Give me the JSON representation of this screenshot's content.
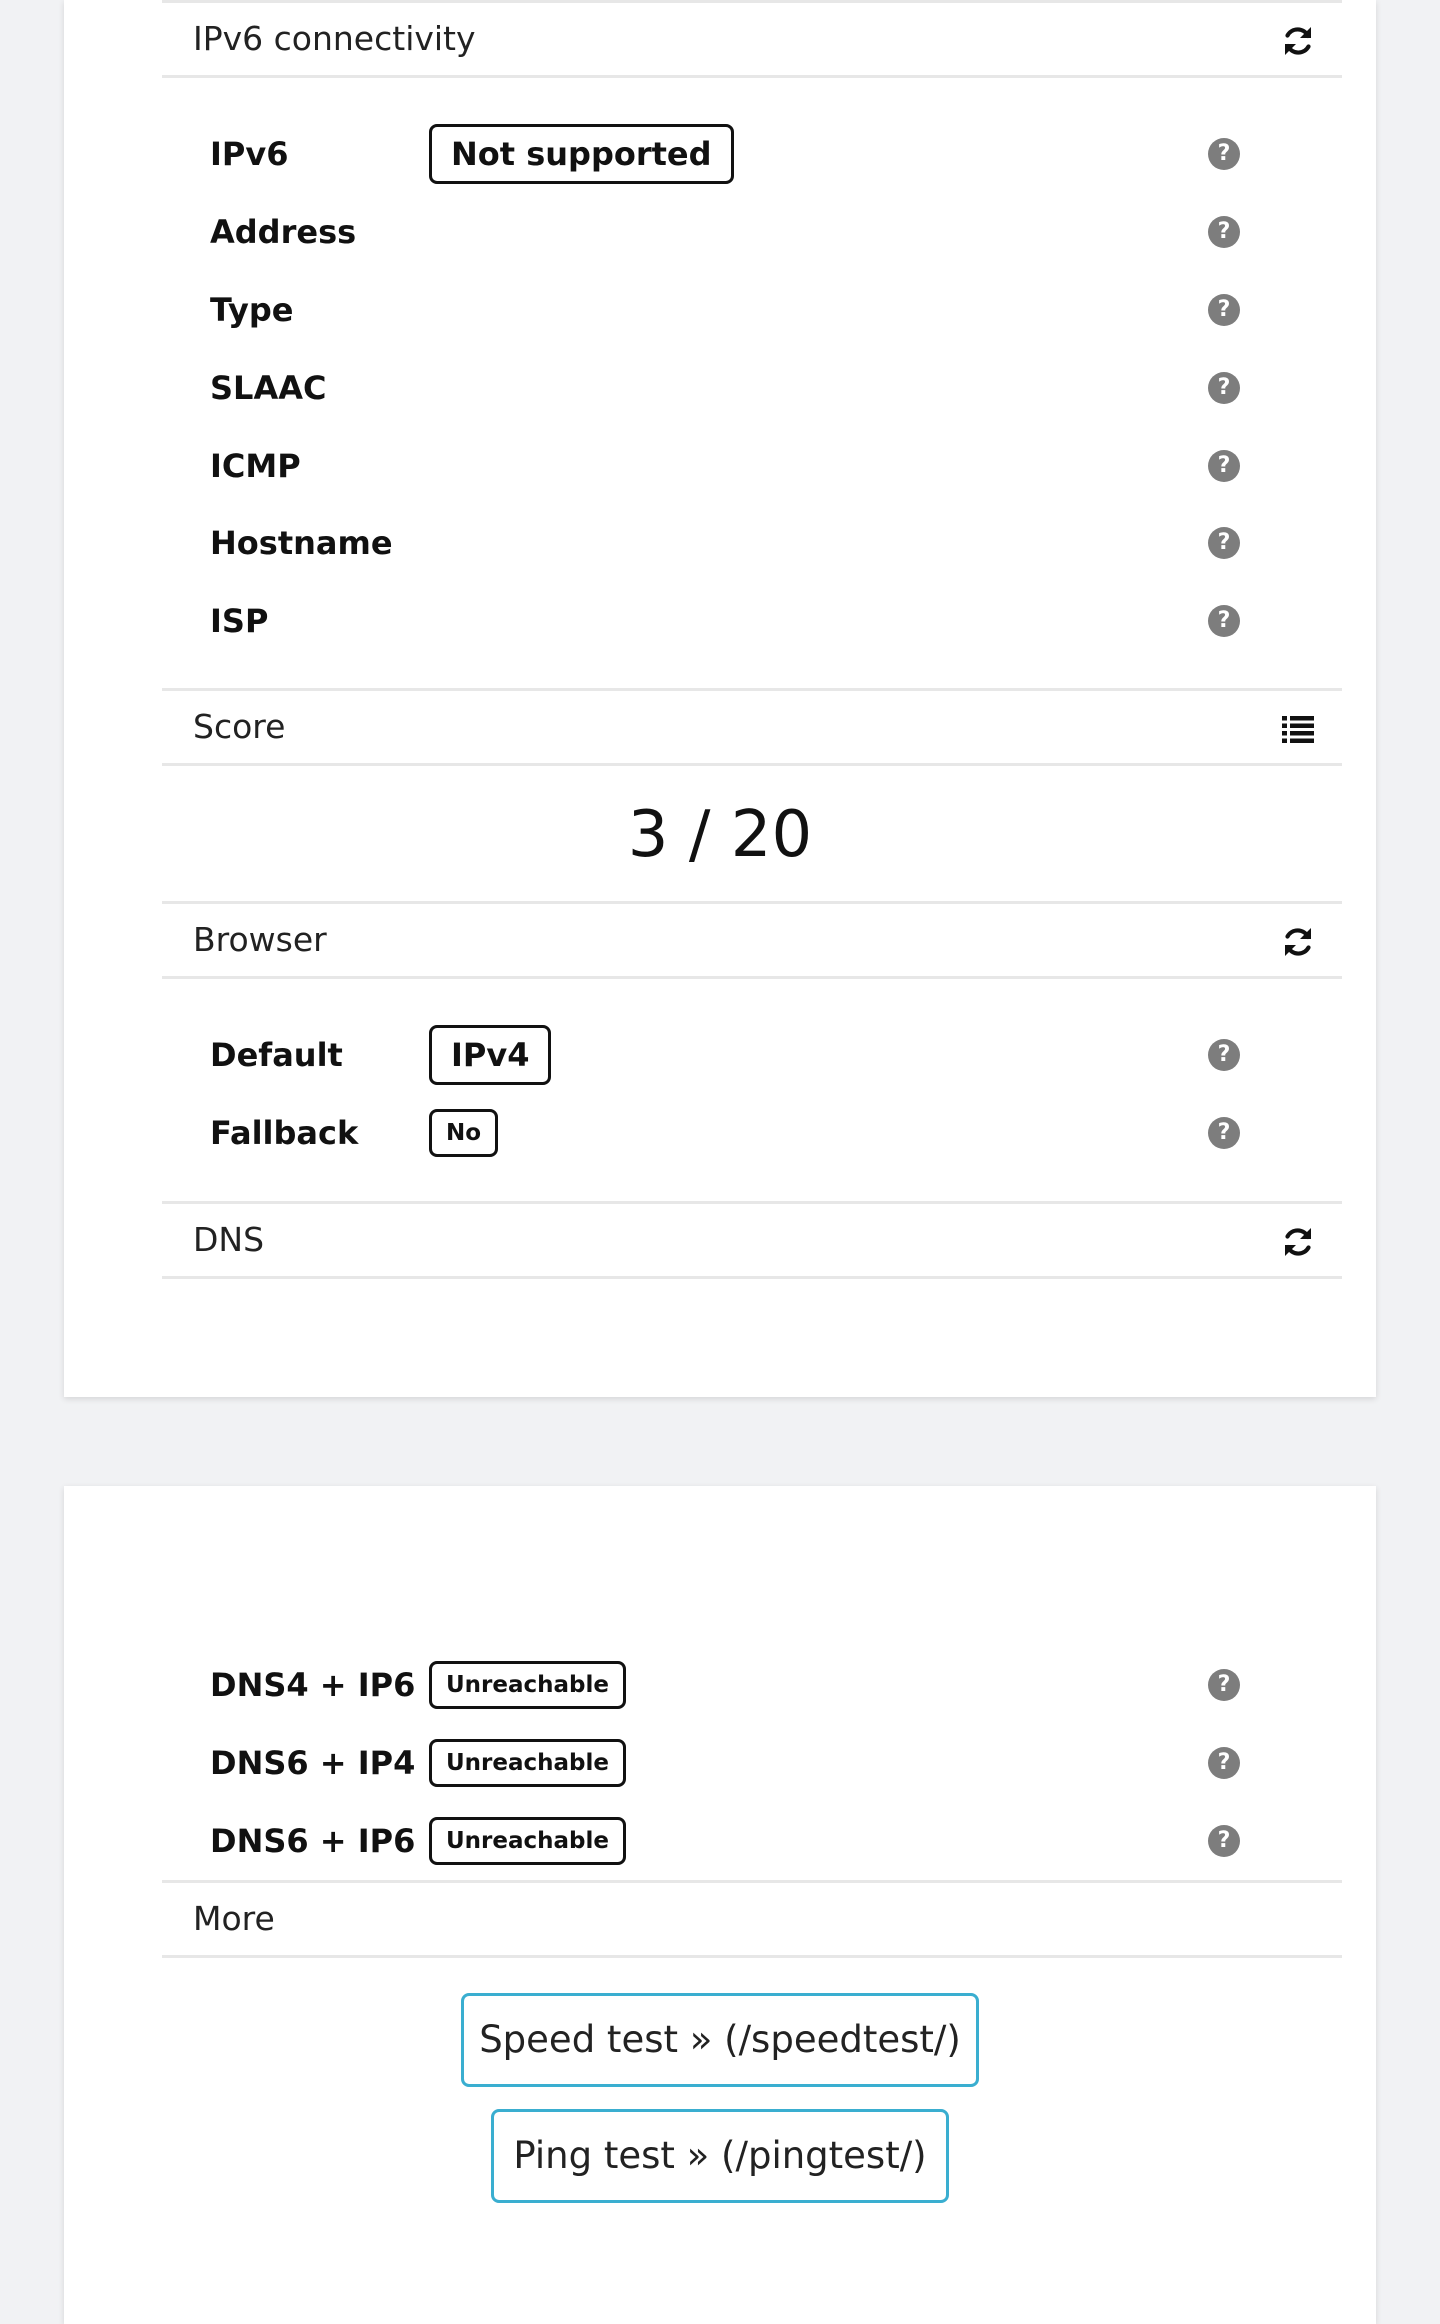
{
  "ipv6": {
    "title": "IPv6 connectivity",
    "icon": "refresh-icon",
    "rows": [
      {
        "label": "IPv6",
        "badge": "Not supported"
      },
      {
        "label": "Address"
      },
      {
        "label": "Type"
      },
      {
        "label": "SLAAC"
      },
      {
        "label": "ICMP"
      },
      {
        "label": "Hostname"
      },
      {
        "label": "ISP"
      }
    ]
  },
  "score": {
    "title": "Score",
    "icon": "list-icon",
    "value": "3 / 20"
  },
  "browser": {
    "title": "Browser",
    "icon": "refresh-icon",
    "rows": [
      {
        "label": "Default",
        "badge": "IPv4"
      },
      {
        "label": "Fallback",
        "badge": "No"
      }
    ]
  },
  "dns": {
    "title": "DNS",
    "icon": "refresh-icon",
    "rows": [
      {
        "label": "DNS4 + IP6",
        "badge": "Unreachable"
      },
      {
        "label": "DNS6 + IP4",
        "badge": "Unreachable"
      },
      {
        "label": "DNS6 + IP6",
        "badge": "Unreachable"
      }
    ]
  },
  "more": {
    "title": "More",
    "buttons": [
      {
        "label": "Speed test » (/speedtest/)"
      },
      {
        "label": "Ping test » (/pingtest/)"
      }
    ]
  },
  "colors": {
    "button_border": "#3aaed0",
    "help_icon": "#7d7d7d",
    "page_bg": "#f1f2f4"
  }
}
